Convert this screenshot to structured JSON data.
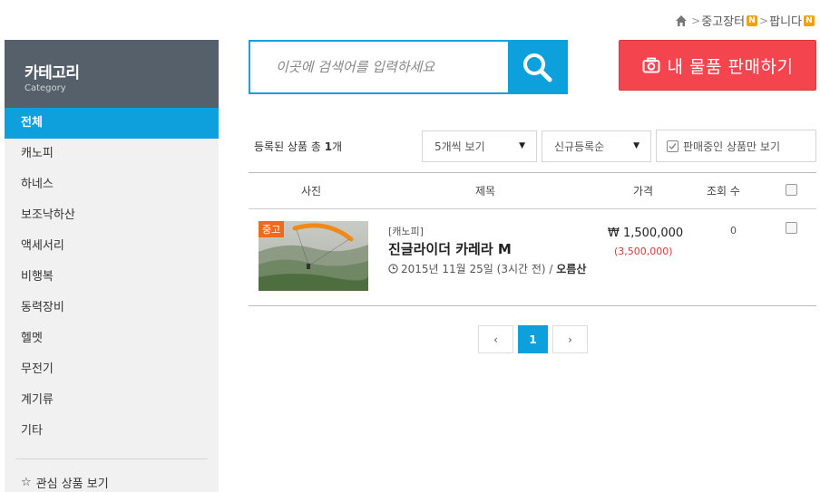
{
  "breadcrumb": {
    "items": [
      "중고장터",
      "팝니다"
    ],
    "badge": "N",
    "separator": ">"
  },
  "sidebar": {
    "title": "카테고리",
    "subtitle": "Category",
    "items": [
      {
        "label": "전체",
        "active": true
      },
      {
        "label": "캐노피"
      },
      {
        "label": "하네스"
      },
      {
        "label": "보조낙하산"
      },
      {
        "label": "액세서리"
      },
      {
        "label": "비행복"
      },
      {
        "label": "동력장비"
      },
      {
        "label": "헬멧"
      },
      {
        "label": "무전기"
      },
      {
        "label": "계기류"
      },
      {
        "label": "기타"
      }
    ],
    "favorites_label": "관심 상품 보기",
    "favorites_icon": "☆"
  },
  "search": {
    "placeholder": "이곳에 검색어를 입력하세요"
  },
  "sell_button": {
    "label": "내 물품 판매하기"
  },
  "toolbar": {
    "count_prefix": "등록된 상품 총 ",
    "count_value": "1",
    "count_suffix": "개",
    "per_page": "5개씩 보기",
    "sort": "신규등록순",
    "filter_label": "판매중인 상품만 보기",
    "arrow": "▼"
  },
  "table": {
    "headers": {
      "photo": "사진",
      "title": "제목",
      "price": "가격",
      "views": "조회 수"
    },
    "rows": [
      {
        "badge": "중고",
        "category": "[캐노피]",
        "title": "진글라이더 카레라 M",
        "date": "2015년 11월 25일 (3시간 전) / ",
        "author": "오름산",
        "price": "₩ 1,500,000",
        "original_price": "(3,500,000)",
        "views": "0"
      }
    ]
  },
  "pagination": {
    "prev": "‹",
    "current": "1",
    "next": "›"
  },
  "colors": {
    "accent": "#0ea0dc",
    "sell": "#f4444e",
    "sidebar_head": "#55606b",
    "badge_used": "#f06a1e"
  }
}
